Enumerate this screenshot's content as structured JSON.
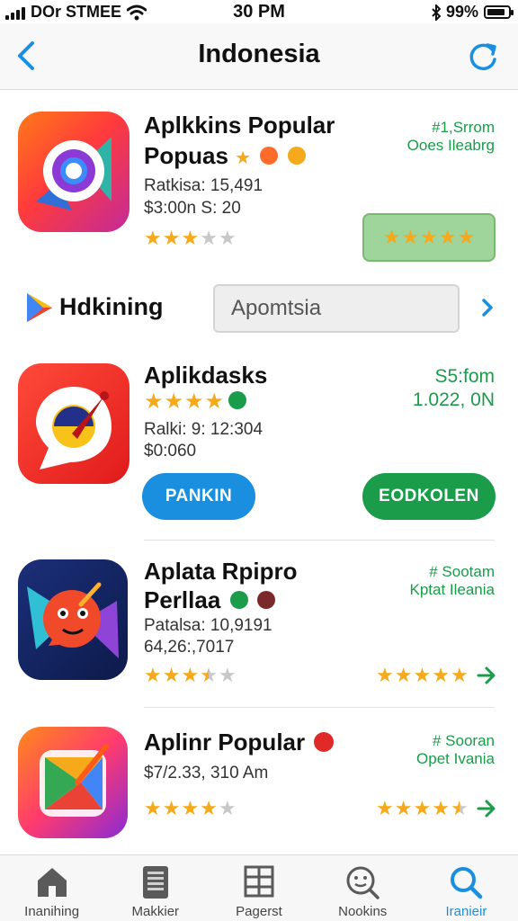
{
  "status_bar": {
    "carrier": "DOr STMEE",
    "time": "30 PM",
    "battery_text": "99%",
    "battery_level": 0.85
  },
  "nav": {
    "title": "Indonesia"
  },
  "apps": [
    {
      "title_line1": "Aplkkins Popular",
      "title_line2": "Popuas",
      "meta_line1": "Ratkisa:  15,491",
      "meta_line2": "$3:00n  S: 20",
      "right_line1": "#1,Srrom",
      "right_line2": "Ooes Ileabrg",
      "rating": 3,
      "right_button_stars": 5
    },
    {
      "title_line1": "Aplikdasks",
      "meta_line1": "Ralki: 9: 12:304",
      "meta_line2": "$0:060",
      "right_line1": "S5:fom",
      "right_line2": "1.022, 0N",
      "rating": 4,
      "left_button": "PANKIN",
      "right_button": "EODKOLEN"
    },
    {
      "title_line1": "Aplata Rpipro",
      "title_line2": "Perllaa",
      "meta_line1": "Patalsa: 10,9191",
      "meta_line2": "64,26:,7017",
      "right_line1": "# Sootam",
      "right_line2": "Kptat Ileania",
      "rating": 3.5,
      "right_rating": 5
    },
    {
      "title_line1": "Aplinr Popular",
      "meta_line1": "$7/2.33,  310 Am",
      "right_line1": "# Sooran",
      "right_line2": "Opet Ivania",
      "rating": 4,
      "right_rating": 4.5
    }
  ],
  "search": {
    "label": "Hdkining",
    "value": "Apomtsia"
  },
  "tabs": [
    {
      "label": "Inanihing"
    },
    {
      "label": "Makkier"
    },
    {
      "label": "Pagerst"
    },
    {
      "label": "Nookins"
    },
    {
      "label": "Iranieir"
    }
  ],
  "colors": {
    "accent_blue": "#1a8fe0",
    "accent_green": "#1a9c4a",
    "star": "#f5a91b"
  }
}
